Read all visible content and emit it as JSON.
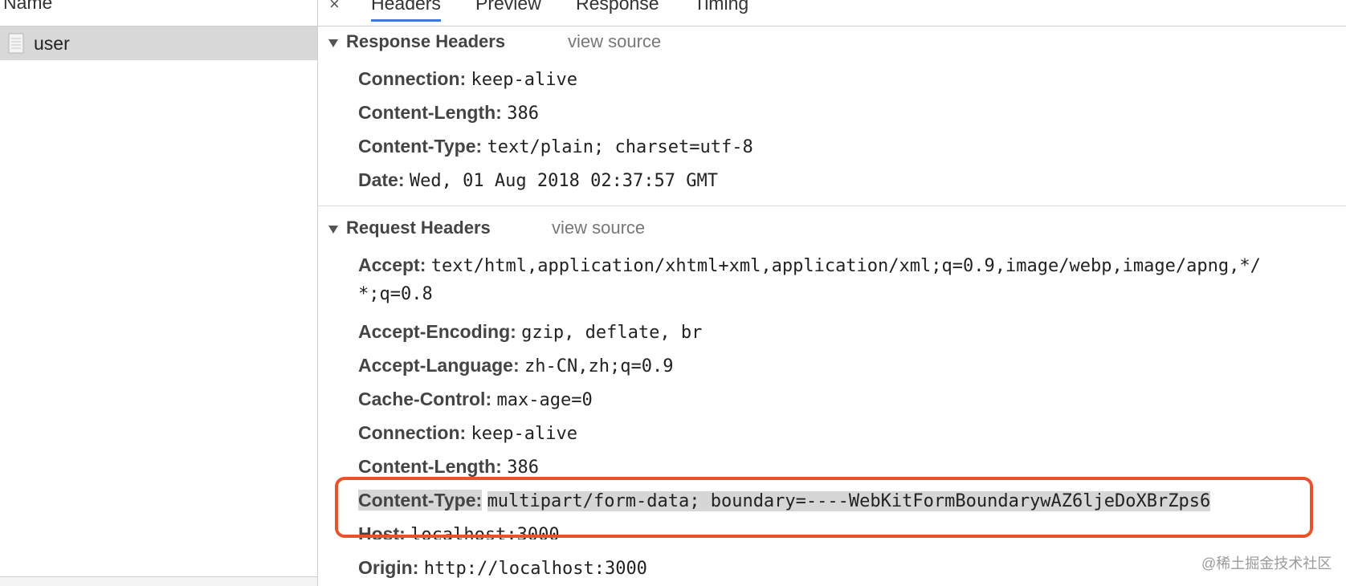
{
  "left_panel": {
    "column_header": "Name",
    "items": [
      {
        "label": "user",
        "icon": "document-icon",
        "selected": true
      }
    ]
  },
  "tabs": {
    "close_icon": "×",
    "items": [
      "Headers",
      "Preview",
      "Response",
      "Timing"
    ],
    "active": "Headers",
    "accent_color": "#3879d9"
  },
  "response_headers": {
    "title": "Response Headers",
    "view_source": "view source",
    "headers": [
      {
        "key": "Connection:",
        "value": "keep-alive"
      },
      {
        "key": "Content-Length:",
        "value": "386"
      },
      {
        "key": "Content-Type:",
        "value": "text/plain; charset=utf-8"
      },
      {
        "key": "Date:",
        "value": "Wed, 01 Aug 2018 02:37:57 GMT"
      }
    ]
  },
  "request_headers": {
    "title": "Request Headers",
    "view_source": "view source",
    "accept": {
      "key": "Accept:",
      "value_line1": "text/html,application/xhtml+xml,application/xml;q=0.9,image/webp,image/apng,*/",
      "value_line2": "*;q=0.8"
    },
    "headers": [
      {
        "key": "Accept-Encoding:",
        "value": "gzip, deflate, br"
      },
      {
        "key": "Accept-Language:",
        "value": "zh-CN,zh;q=0.9"
      },
      {
        "key": "Cache-Control:",
        "value": "max-age=0"
      },
      {
        "key": "Connection:",
        "value": "keep-alive"
      },
      {
        "key": "Content-Length:",
        "value": "386"
      },
      {
        "key": "Content-Type:",
        "value": "multipart/form-data; boundary=----WebKitFormBoundarywAZ6ljeDoXBrZps6",
        "highlighted": true
      },
      {
        "key": "Host:",
        "value": "localhost:3000"
      },
      {
        "key": "Origin:",
        "value": "http://localhost:3000"
      }
    ]
  },
  "callout_color": "#e8532c",
  "watermark": "@稀土掘金技术社区"
}
